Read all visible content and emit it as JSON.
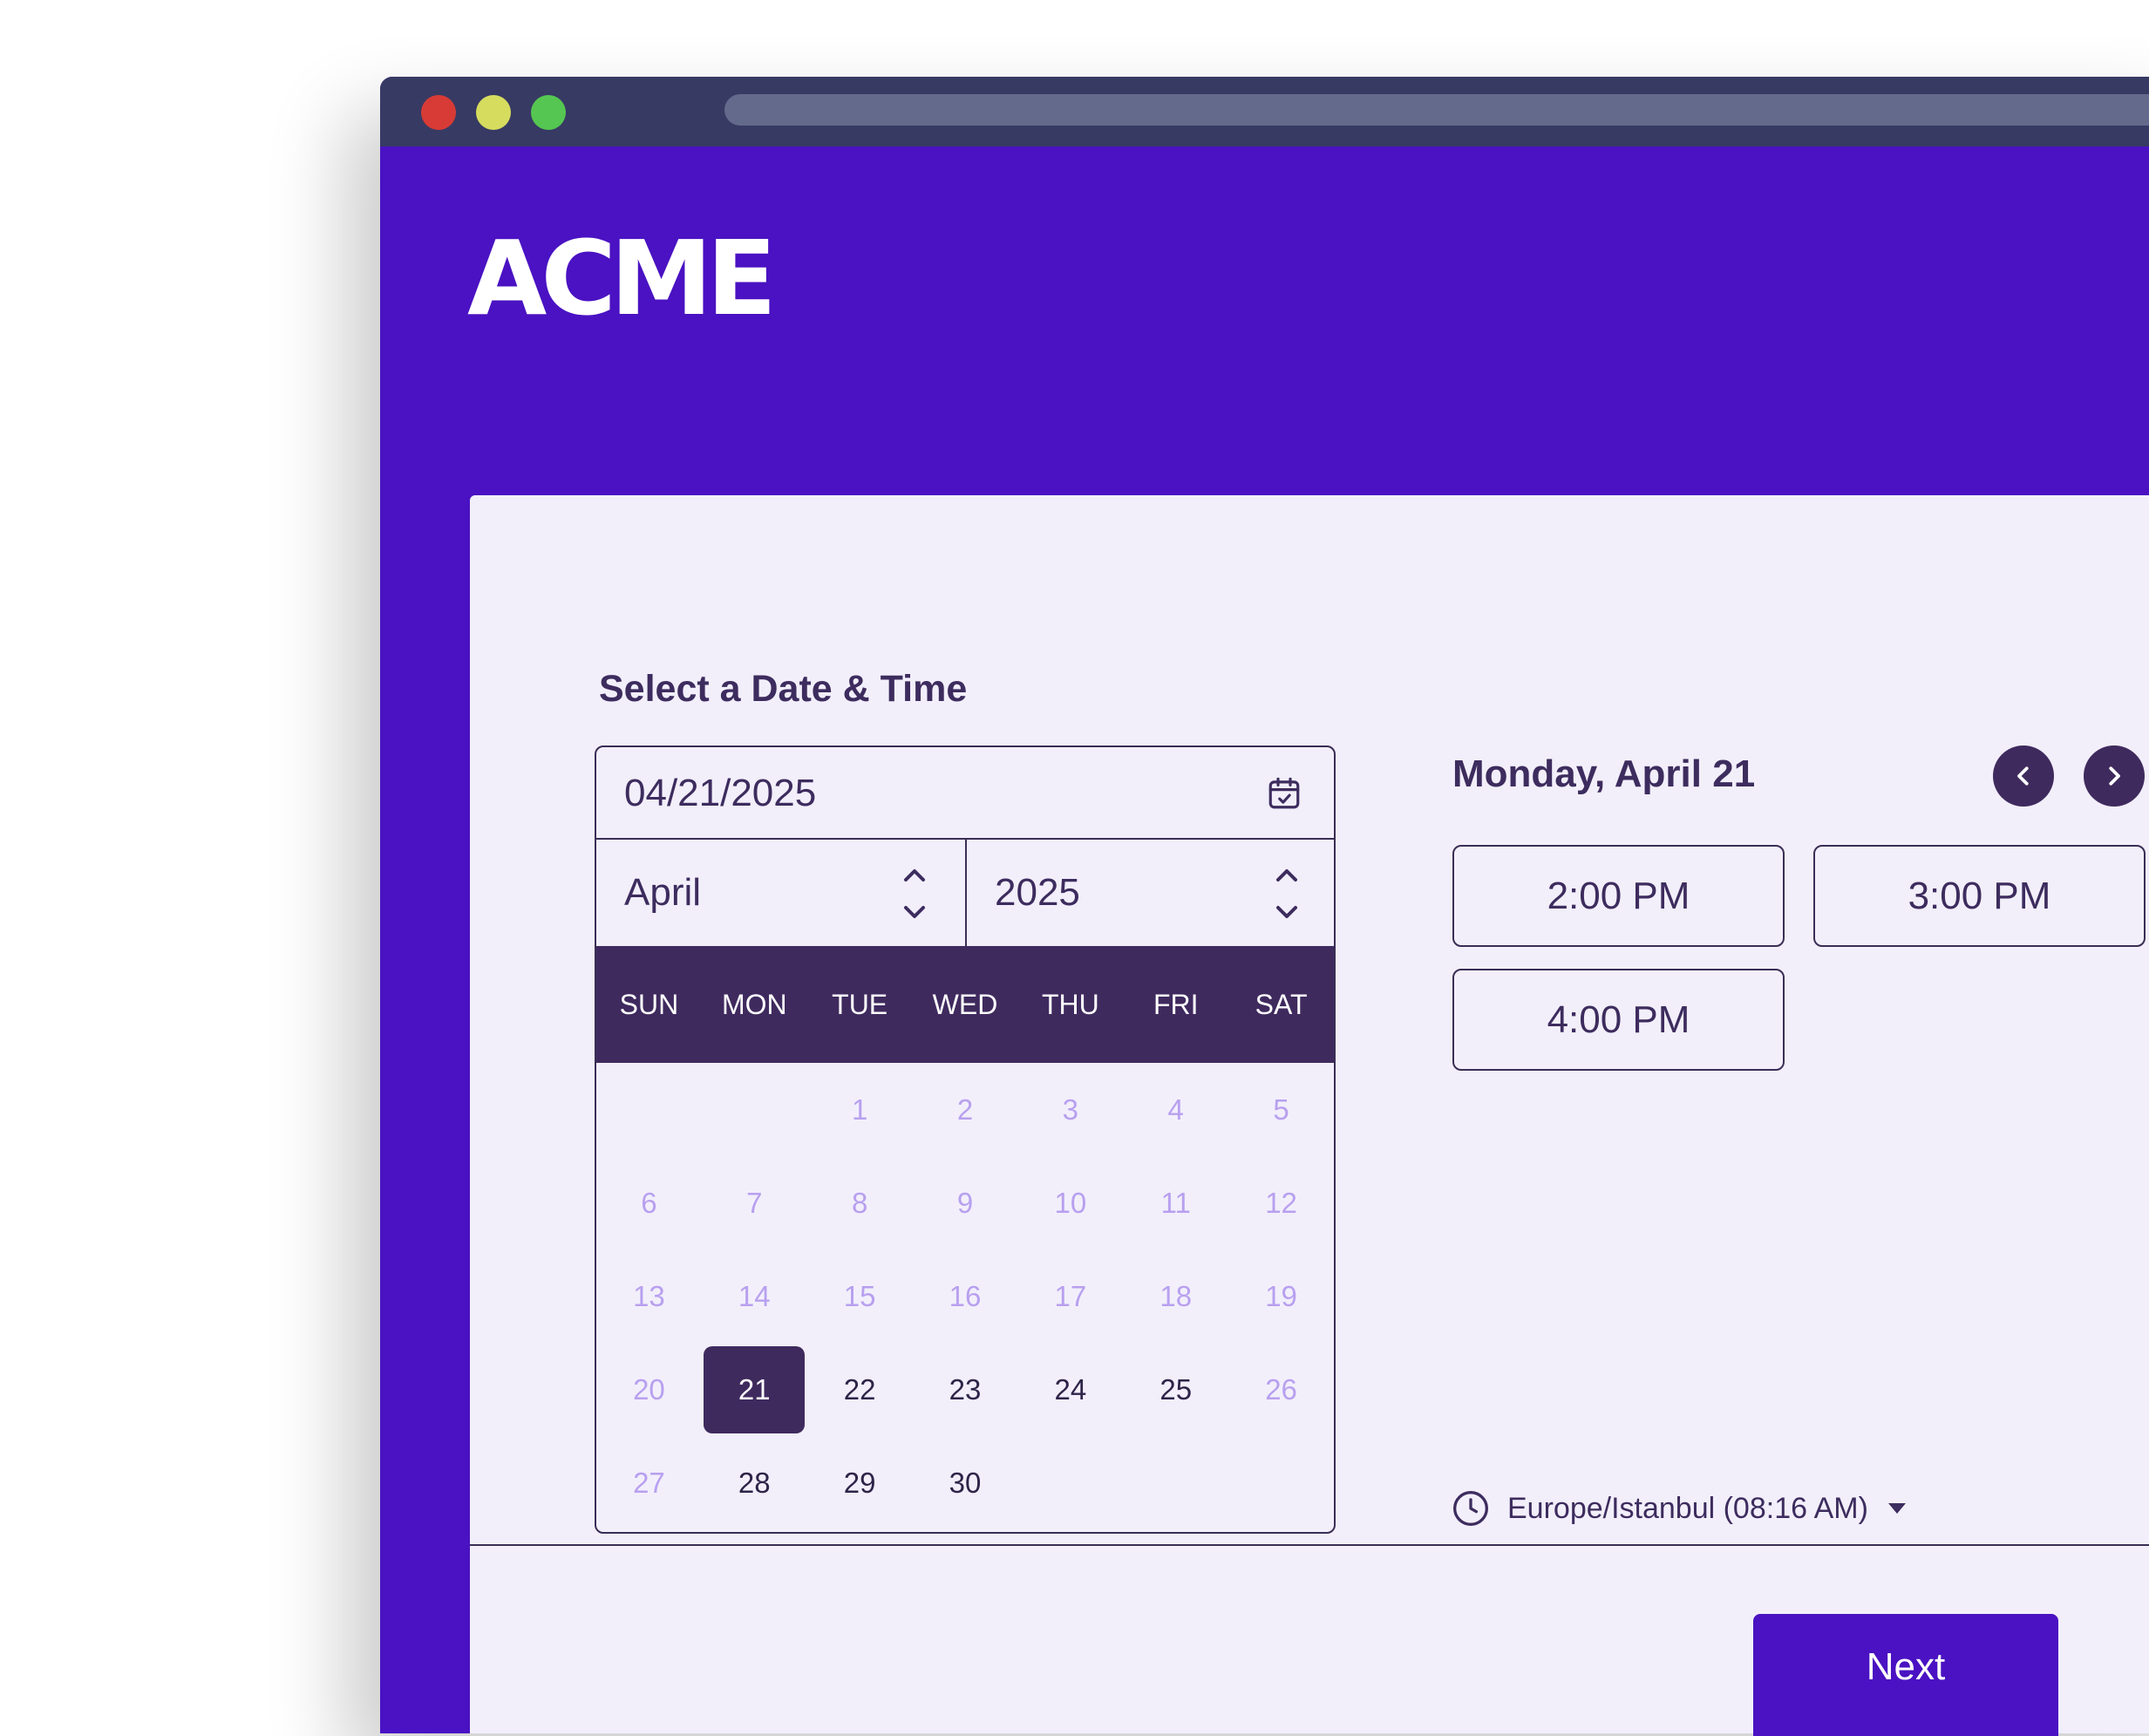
{
  "brand": {
    "logo_text": "ACME"
  },
  "scheduler": {
    "heading": "Select a Date & Time",
    "date_input_value": "04/21/2025",
    "month_value": "April",
    "year_value": "2025",
    "weekdays": [
      "SUN",
      "MON",
      "TUE",
      "WED",
      "THU",
      "FRI",
      "SAT"
    ],
    "days": [
      {
        "label": "",
        "state": "empty"
      },
      {
        "label": "",
        "state": "empty"
      },
      {
        "label": "1",
        "state": "disabled"
      },
      {
        "label": "2",
        "state": "disabled"
      },
      {
        "label": "3",
        "state": "disabled"
      },
      {
        "label": "4",
        "state": "disabled"
      },
      {
        "label": "5",
        "state": "disabled"
      },
      {
        "label": "6",
        "state": "disabled"
      },
      {
        "label": "7",
        "state": "disabled"
      },
      {
        "label": "8",
        "state": "disabled"
      },
      {
        "label": "9",
        "state": "disabled"
      },
      {
        "label": "10",
        "state": "disabled"
      },
      {
        "label": "11",
        "state": "disabled"
      },
      {
        "label": "12",
        "state": "disabled"
      },
      {
        "label": "13",
        "state": "disabled"
      },
      {
        "label": "14",
        "state": "disabled"
      },
      {
        "label": "15",
        "state": "disabled"
      },
      {
        "label": "16",
        "state": "disabled"
      },
      {
        "label": "17",
        "state": "disabled"
      },
      {
        "label": "18",
        "state": "disabled"
      },
      {
        "label": "19",
        "state": "disabled"
      },
      {
        "label": "20",
        "state": "disabled"
      },
      {
        "label": "21",
        "state": "selected"
      },
      {
        "label": "22",
        "state": "available"
      },
      {
        "label": "23",
        "state": "available"
      },
      {
        "label": "24",
        "state": "available"
      },
      {
        "label": "25",
        "state": "available"
      },
      {
        "label": "26",
        "state": "disabled"
      },
      {
        "label": "27",
        "state": "disabled"
      },
      {
        "label": "28",
        "state": "available"
      },
      {
        "label": "29",
        "state": "available"
      },
      {
        "label": "30",
        "state": "available"
      }
    ],
    "selected_day_title": "Monday, April 21",
    "time_slots": [
      "2:00 PM",
      "3:00 PM",
      "4:00 PM"
    ],
    "timezone_label": "Europe/Istanbul (08:16 AM)",
    "next_label": "Next"
  },
  "icons": {
    "calendar": "calendar-check-icon",
    "stepper": "chevron-up-down-icon",
    "prev": "chevron-left-icon",
    "next": "chevron-right-icon",
    "clock": "clock-icon",
    "dropdown": "caret-down-icon"
  },
  "colors": {
    "brand_purple": "#4a12c2",
    "dark_purple": "#3f2a5e",
    "card_background": "#f2effb",
    "disabled_day": "#b8a0ef",
    "titlebar": "#373a63"
  }
}
